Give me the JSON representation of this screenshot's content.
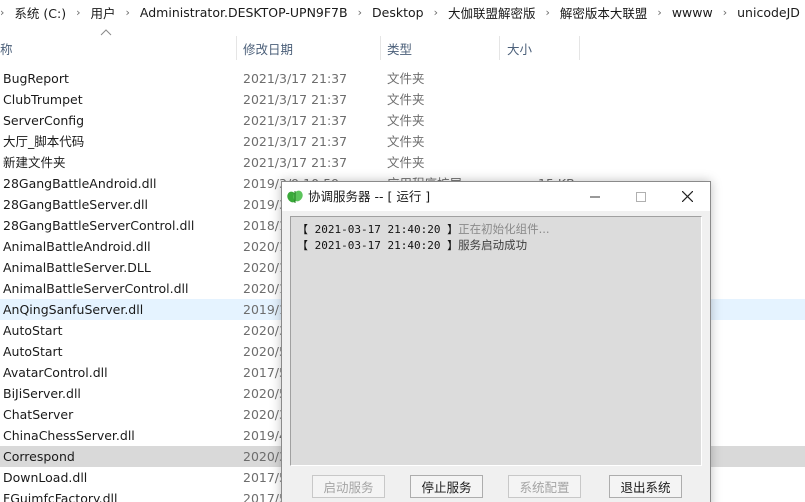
{
  "breadcrumb": [
    "系统 (C:)",
    "用户",
    "Administrator.DESKTOP-UPN9F7B",
    "Desktop",
    "大伽联盟解密版",
    "解密版本大联盟",
    "wwww",
    "unicodeJD"
  ],
  "columns": {
    "name": "称",
    "date": "修改日期",
    "type": "类型",
    "size": "大小"
  },
  "files": [
    {
      "name": "BugReport",
      "date": "2021/3/17 21:37",
      "type": "文件夹",
      "size": ""
    },
    {
      "name": "ClubTrumpet",
      "date": "2021/3/17 21:37",
      "type": "文件夹",
      "size": ""
    },
    {
      "name": "ServerConfig",
      "date": "2021/3/17 21:37",
      "type": "文件夹",
      "size": ""
    },
    {
      "name": "大厅_脚本代码",
      "date": "2021/3/17 21:37",
      "type": "文件夹",
      "size": ""
    },
    {
      "name": "新建文件夹",
      "date": "2021/3/17 21:37",
      "type": "文件夹",
      "size": ""
    },
    {
      "name": "28GangBattleAndroid.dll",
      "date": "2019/3/9 10:59",
      "type": "应用程序扩展",
      "size": "15 KB"
    },
    {
      "name": "28GangBattleServer.dll",
      "date": "2019/3",
      "type": "",
      "size": ""
    },
    {
      "name": "28GangBattleServerControl.dll",
      "date": "2018/1",
      "type": "",
      "size": ""
    },
    {
      "name": "AnimalBattleAndroid.dll",
      "date": "2020/1",
      "type": "",
      "size": ""
    },
    {
      "name": "AnimalBattleServer.DLL",
      "date": "2020/1",
      "type": "",
      "size": ""
    },
    {
      "name": "AnimalBattleServerControl.dll",
      "date": "2020/1",
      "type": "",
      "size": ""
    },
    {
      "name": "AnQingSanfuServer.dll",
      "date": "2019/1",
      "type": "",
      "size": ""
    },
    {
      "name": "AutoStart",
      "date": "2020/3",
      "type": "",
      "size": ""
    },
    {
      "name": "AutoStart",
      "date": "2020/5",
      "type": "",
      "size": ""
    },
    {
      "name": "AvatarControl.dll",
      "date": "2017/5",
      "type": "",
      "size": ""
    },
    {
      "name": "BiJiServer.dll",
      "date": "2020/5",
      "type": "",
      "size": ""
    },
    {
      "name": "ChatServer",
      "date": "2020/3",
      "type": "",
      "size": ""
    },
    {
      "name": "ChinaChessServer.dll",
      "date": "2019/4",
      "type": "",
      "size": ""
    },
    {
      "name": "Correspond",
      "date": "2020/3",
      "type": "",
      "size": ""
    },
    {
      "name": "DownLoad.dll",
      "date": "2017/5",
      "type": "",
      "size": ""
    },
    {
      "name": "FGuimfcFactory.dll",
      "date": "2017/5",
      "type": "",
      "size": ""
    }
  ],
  "dialog": {
    "title": "协调服务器 -- [ 运行 ]",
    "log": [
      {
        "time": "【 2021-03-17 21:40:20 】",
        "msg": "正在初始化组件..."
      },
      {
        "time": "【 2021-03-17 21:40:20 】",
        "msg": "服务启动成功"
      }
    ],
    "buttons": {
      "start": "启动服务",
      "stop": "停止服务",
      "config": "系统配置",
      "exit": "退出系统"
    }
  },
  "colors": {
    "hover_row": "#e5f3ff",
    "selected_row": "#d9d9d9",
    "header_text": "#4c607a",
    "app_icon": "#3aa93a"
  },
  "icons": {
    "app": "green-leaf-icon",
    "minimize": "minimize-icon",
    "maximize": "maximize-icon",
    "close": "close-icon",
    "sort": "sort-up-icon"
  }
}
